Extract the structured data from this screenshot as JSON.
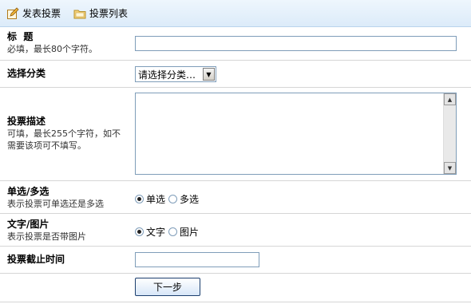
{
  "toolbar": {
    "publish_label": "发表投票",
    "list_label": "投票列表"
  },
  "form": {
    "title": {
      "label": "标  题",
      "hint": "必填，最长80个字符。",
      "value": ""
    },
    "category": {
      "label": "选择分类",
      "selected": "请选择分类…"
    },
    "description": {
      "label": "投票描述",
      "hint": "可填，最长255个字符，如不需要该项可不填写。"
    },
    "mode": {
      "label": "单选/多选",
      "hint": "表示投票可单选还是多选",
      "options": [
        "单选",
        "多选"
      ],
      "selected": "单选"
    },
    "type": {
      "label": "文字/图片",
      "hint": "表示投票是否带图片",
      "options": [
        "文字",
        "图片"
      ],
      "selected": "文字"
    },
    "deadline": {
      "label": "投票截止时间",
      "value": ""
    },
    "next_label": "下一步"
  },
  "icons": {
    "publish": "edit-icon",
    "list": "folder-icon"
  }
}
